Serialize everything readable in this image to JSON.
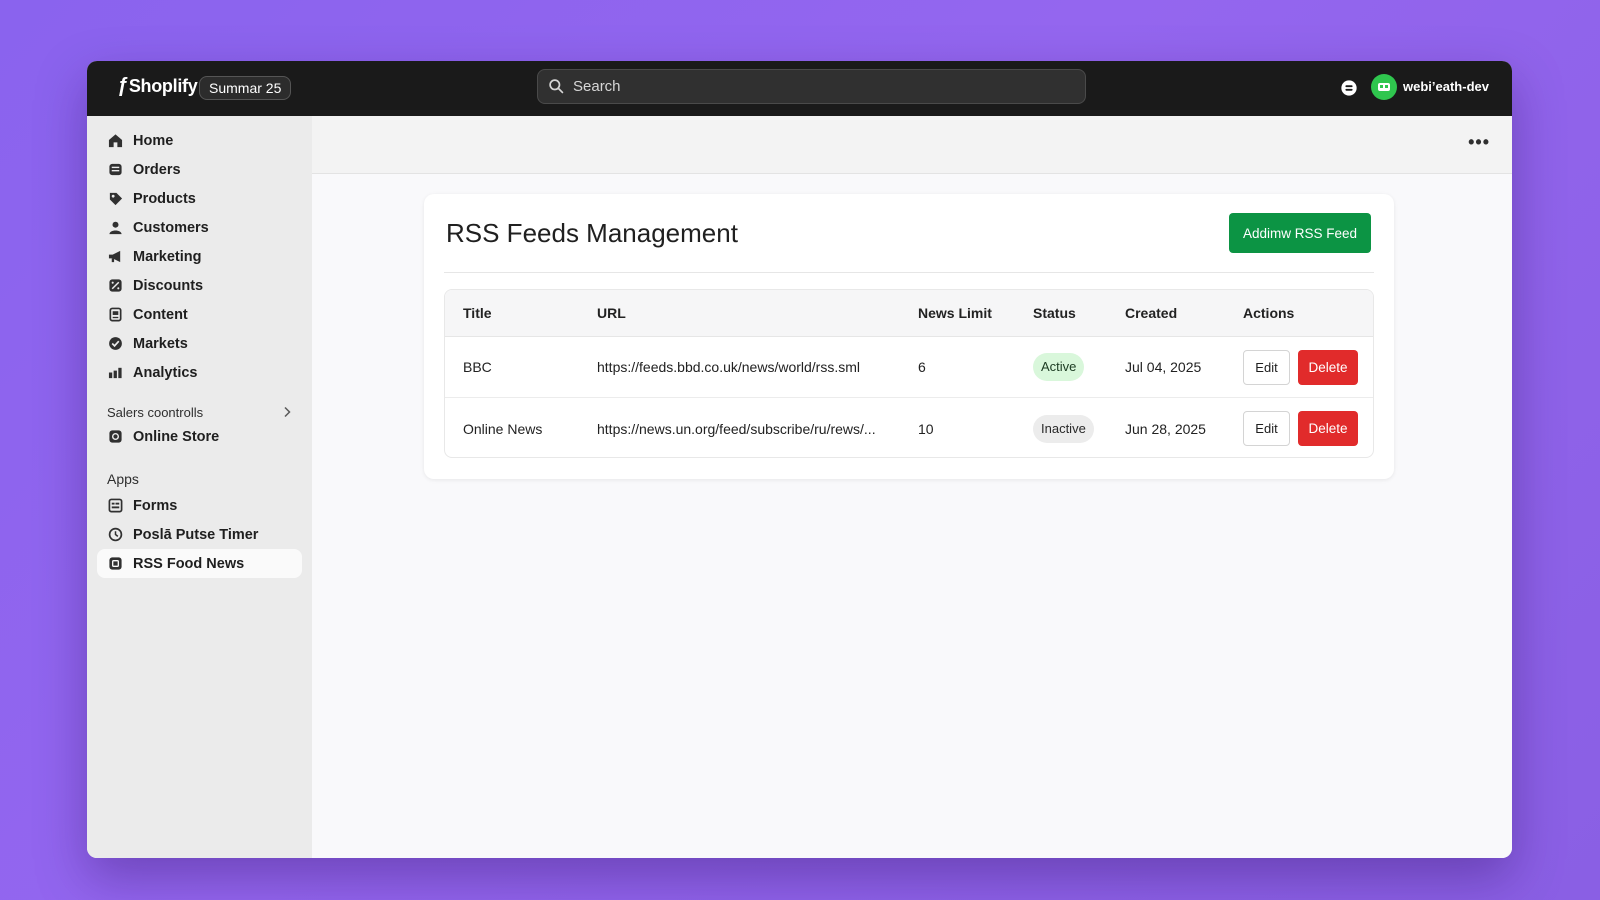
{
  "topbar": {
    "brand": "Shoplify",
    "edition": "Summar 25",
    "search_placeholder": "Search",
    "store_name": "webi’eath-dev"
  },
  "sidebar": {
    "items": [
      {
        "label": "Home",
        "icon": "home-icon"
      },
      {
        "label": "Orders",
        "icon": "orders-icon"
      },
      {
        "label": "Products",
        "icon": "tag-icon"
      },
      {
        "label": "Customers",
        "icon": "person-icon"
      },
      {
        "label": "Marketing",
        "icon": "megaphone-icon"
      },
      {
        "label": "Discounts",
        "icon": "discount-icon"
      },
      {
        "label": "Content",
        "icon": "content-icon"
      },
      {
        "label": "Markets",
        "icon": "globe-icon"
      },
      {
        "label": "Analytics",
        "icon": "bar-chart-icon"
      }
    ],
    "sales_channels_label": "Salers coontrolls",
    "sales_channels": [
      {
        "label": "Online Store",
        "icon": "store-icon"
      }
    ],
    "apps_label": "Apps",
    "apps": [
      {
        "label": "Forms",
        "icon": "form-icon"
      },
      {
        "label": "Poslā Putse Timer",
        "icon": "timer-icon"
      },
      {
        "label": "RSS Food News",
        "icon": "app-icon"
      }
    ]
  },
  "main": {
    "more_label": "•••",
    "card": {
      "title": "RSS Feeds Management",
      "add_button": "Addimw RSS Feed",
      "columns": [
        "Title",
        "URL",
        "News Limit",
        "Status",
        "Created",
        "Actions"
      ],
      "rows": [
        {
          "title": "BBC",
          "url": "https://feeds.bbd.co.uk/news/world/rss.sml",
          "limit": "6",
          "status": "Active",
          "created": "Jul 04, 2025",
          "edit": "Edit",
          "delete": "Delete"
        },
        {
          "title": "Online News",
          "url": "https://news.un.org/feed/subscribe/ru/rews/...",
          "limit": "10",
          "status": "Inactive",
          "created": "Jun 28, 2025",
          "edit": "Edit",
          "delete": "Delete"
        }
      ]
    }
  },
  "colors": {
    "background": "#8a63ee",
    "topbar": "#1a1a1a",
    "primary": "#0c9444",
    "danger": "#e12b2b",
    "active_badge": "#d9f7db",
    "avatar": "#2fc64e"
  }
}
